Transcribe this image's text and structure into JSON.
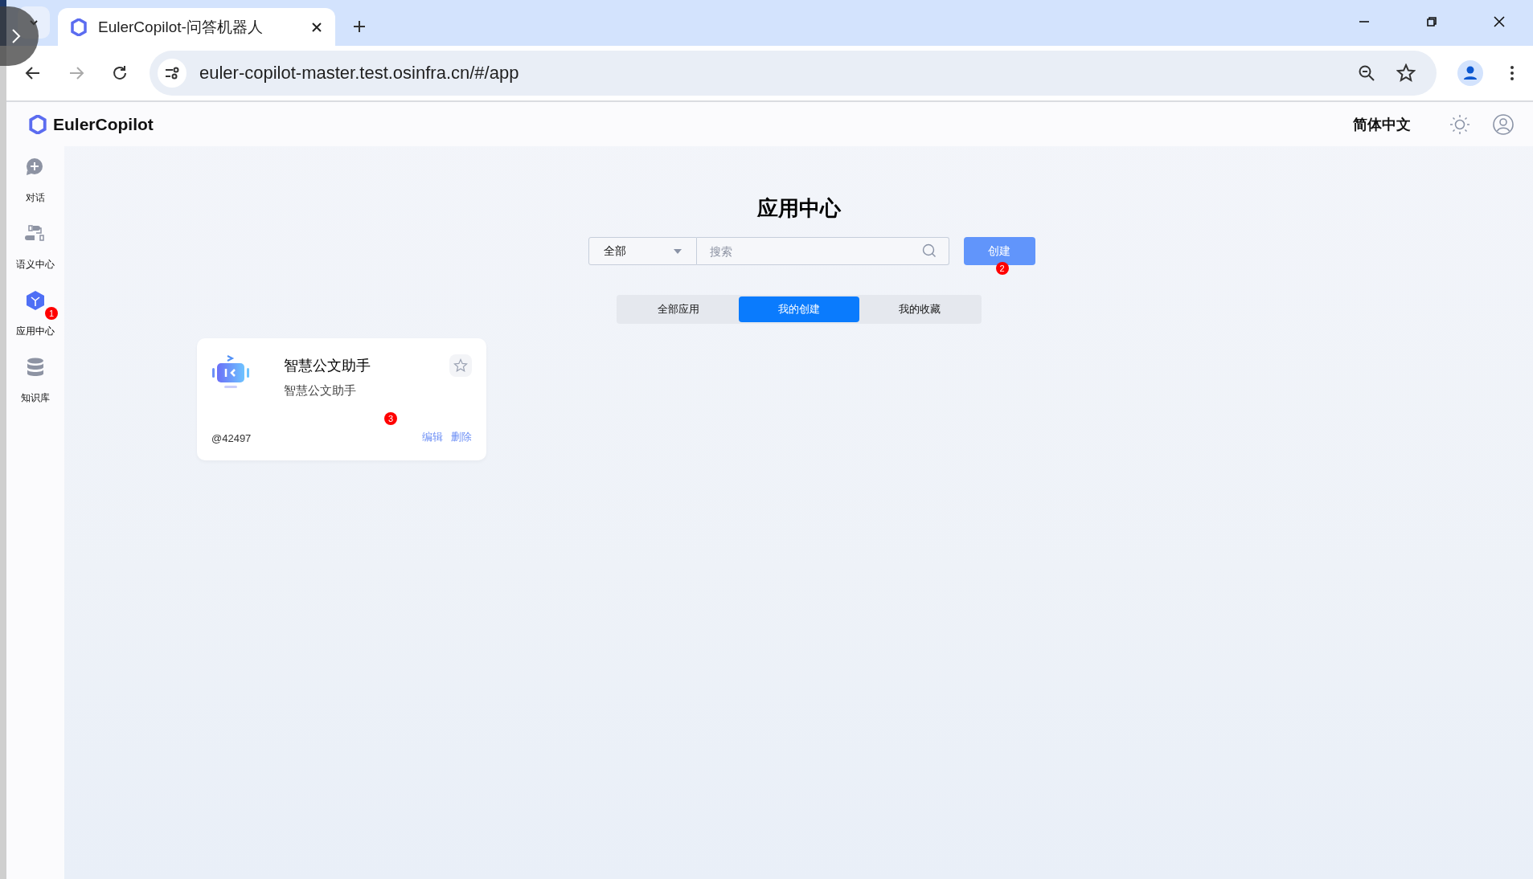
{
  "browser": {
    "tab_title": "EulerCopilot-问答机器人",
    "url": "euler-copilot-master.test.osinfra.cn/#/app"
  },
  "app": {
    "brand": "EulerCopilot",
    "language": "简体中文",
    "nav": [
      {
        "label": "对话",
        "kind": "chat",
        "selected": false
      },
      {
        "label": "语义中心",
        "kind": "plugin",
        "selected": false
      },
      {
        "label": "应用中心",
        "kind": "app",
        "selected": true,
        "badge": "1"
      },
      {
        "label": "知识库",
        "kind": "database",
        "selected": false
      }
    ],
    "page_title": "应用中心",
    "filter": {
      "value": "全部"
    },
    "search": {
      "placeholder": "搜索"
    },
    "create_button": {
      "label": "创建",
      "badge": "2"
    },
    "tabs": [
      {
        "label": "全部应用",
        "selected": false
      },
      {
        "label": "我的创建",
        "selected": true
      },
      {
        "label": "我的收藏",
        "selected": false
      }
    ],
    "cards": [
      {
        "name": "智慧公文助手",
        "description": "智慧公文助手",
        "author": "@42497",
        "favorited": false,
        "badge": "3",
        "actions": [
          "编辑",
          "删除"
        ]
      }
    ]
  }
}
